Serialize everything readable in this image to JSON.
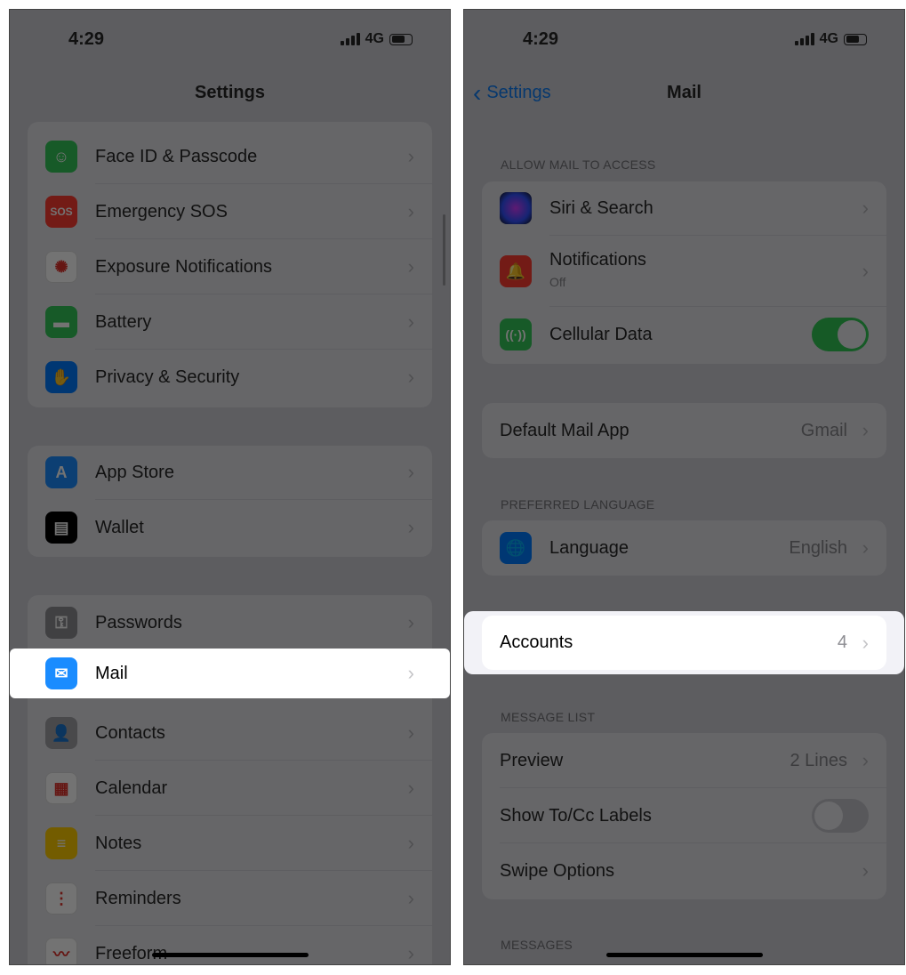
{
  "left": {
    "time": "4:29",
    "network": "4G",
    "title": "Settings",
    "groups": [
      [
        {
          "label": "Face ID & Passcode",
          "icon": "face-id-icon",
          "color": "#34c759",
          "glyph": "☺"
        },
        {
          "label": "Emergency SOS",
          "icon": "sos-icon",
          "color": "#ff3b30",
          "glyph": "SOS"
        },
        {
          "label": "Exposure Notifications",
          "icon": "exposure-icon",
          "color": "#ffffff",
          "glyph": "✺"
        },
        {
          "label": "Battery",
          "icon": "battery-icon",
          "color": "#34c759",
          "glyph": "▬"
        },
        {
          "label": "Privacy & Security",
          "icon": "hand-icon",
          "color": "#007aff",
          "glyph": "✋"
        }
      ],
      [
        {
          "label": "App Store",
          "icon": "app-store-icon",
          "color": "#1a8cff",
          "glyph": "A"
        },
        {
          "label": "Wallet",
          "icon": "wallet-icon",
          "color": "#000000",
          "glyph": "▤"
        }
      ],
      [
        {
          "label": "Passwords",
          "icon": "key-icon",
          "color": "#8e8e93",
          "glyph": "⚿"
        },
        {
          "label": "Mail",
          "icon": "mail-icon",
          "color": "#1a8cff",
          "glyph": "✉"
        },
        {
          "label": "Contacts",
          "icon": "contacts-icon",
          "color": "#a2a2a7",
          "glyph": "👤"
        },
        {
          "label": "Calendar",
          "icon": "calendar-icon",
          "color": "#ffffff",
          "glyph": "▦"
        },
        {
          "label": "Notes",
          "icon": "notes-icon",
          "color": "#ffcc00",
          "glyph": "≡"
        },
        {
          "label": "Reminders",
          "icon": "reminders-icon",
          "color": "#ffffff",
          "glyph": "⋮"
        },
        {
          "label": "Freeform",
          "icon": "freeform-icon",
          "color": "#ffffff",
          "glyph": "〰"
        }
      ]
    ]
  },
  "right": {
    "time": "4:29",
    "network": "4G",
    "back": "Settings",
    "title": "Mail",
    "allow_header": "ALLOW MAIL TO ACCESS",
    "siri": "Siri & Search",
    "notifications": "Notifications",
    "notifications_sub": "Off",
    "cellular": "Cellular Data",
    "cellular_on": true,
    "default_app": "Default Mail App",
    "default_app_value": "Gmail",
    "lang_header": "PREFERRED LANGUAGE",
    "language": "Language",
    "language_value": "English",
    "accounts": "Accounts",
    "accounts_value": "4",
    "msglist_header": "MESSAGE LIST",
    "preview": "Preview",
    "preview_value": "2 Lines",
    "tocc": "Show To/Cc Labels",
    "tocc_on": false,
    "swipe": "Swipe Options",
    "messages_header": "MESSAGES"
  }
}
